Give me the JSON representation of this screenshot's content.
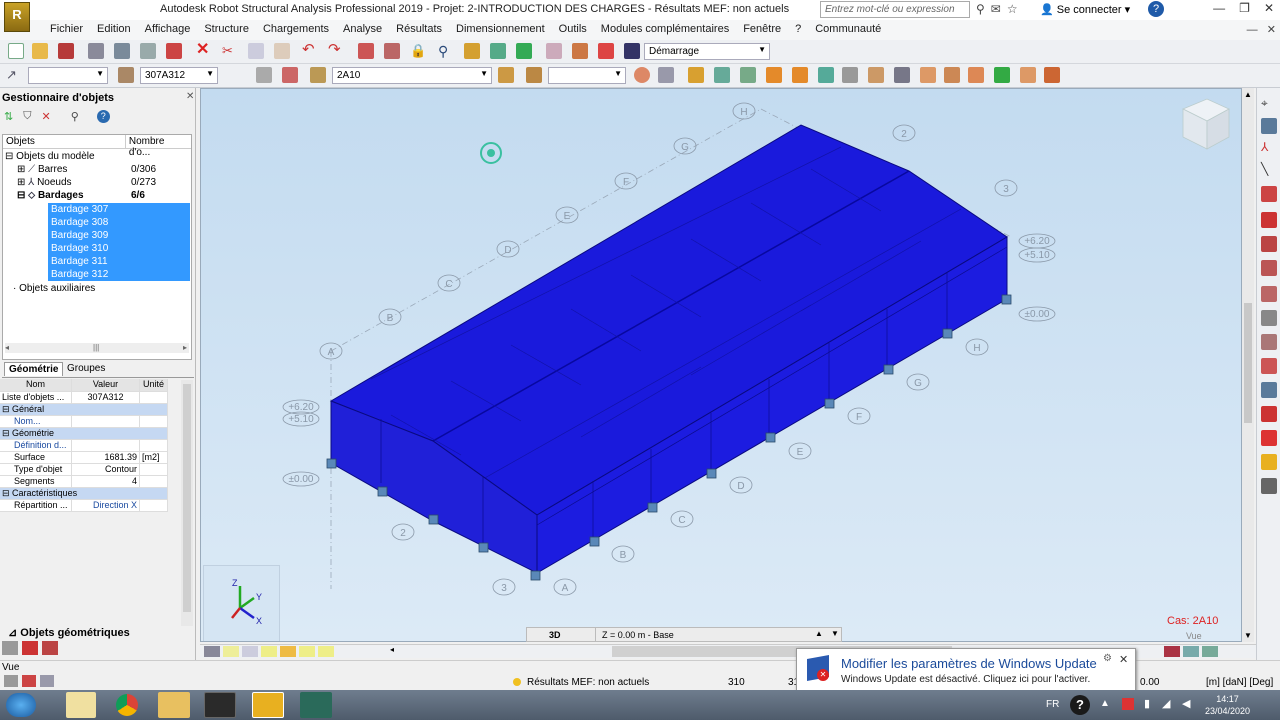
{
  "titlebar": {
    "logo": "R",
    "title": "Autodesk Robot Structural Analysis Professional 2019 - Projet: 2-INTRODUCTION DES CHARGES - Résultats MEF: non actuels",
    "search_placeholder": "Entrez mot-clé ou expression",
    "user": "Se connecter",
    "help": "?"
  },
  "menu": {
    "items": [
      "Fichier",
      "Edition",
      "Affichage",
      "Structure",
      "Chargements",
      "Analyse",
      "Résultats",
      "Dimensionnement",
      "Outils",
      "Modules complémentaires",
      "Fenêtre",
      "?",
      "Communauté"
    ]
  },
  "toolbar1": {
    "layout_select": "Démarrage"
  },
  "toolbar2": {
    "section_select": "307A312",
    "case_select": "2A10"
  },
  "object_manager": {
    "title": "Gestionnaire d'objets",
    "col_objects": "Objets",
    "col_count": "Nombre d'o...",
    "root": "Objets du modèle",
    "nodes": [
      {
        "label": "Barres",
        "count": "0/306"
      },
      {
        "label": "Noeuds",
        "count": "0/273"
      },
      {
        "label": "Bardages",
        "count": "6/6"
      }
    ],
    "claddings": [
      "Bardage   307",
      "Bardage   308",
      "Bardage   309",
      "Bardage   310",
      "Bardage   311",
      "Bardage   312"
    ],
    "aux": "Objets auxiliaires",
    "tab_geometry": "Géométrie",
    "tab_groups": "Groupes"
  },
  "properties": {
    "head": [
      "Nom",
      "Valeur",
      "Unité"
    ],
    "rows": [
      {
        "name": "Liste d'objets ...",
        "value": "307A312",
        "unit": "",
        "type": "plain"
      },
      {
        "name": "Général",
        "value": "",
        "unit": "",
        "type": "group"
      },
      {
        "name": "Nom...",
        "value": "",
        "unit": "",
        "type": "sub"
      },
      {
        "name": "Géométrie",
        "value": "",
        "unit": "",
        "type": "group"
      },
      {
        "name": "Définition d...",
        "value": "",
        "unit": "",
        "type": "sub"
      },
      {
        "name": "Surface",
        "value": "1681.39",
        "unit": "[m2]",
        "type": "plain"
      },
      {
        "name": "Type d'objet",
        "value": "Contour",
        "unit": "",
        "type": "plain"
      },
      {
        "name": "Segments",
        "value": "4",
        "unit": "",
        "type": "plain"
      },
      {
        "name": "Caractéristiques",
        "value": "",
        "unit": "",
        "type": "group"
      },
      {
        "name": "Répartition ...",
        "value": "Direction X",
        "unit": "",
        "type": "sub"
      }
    ],
    "bottom_tab": "Objets géométriques"
  },
  "viewport": {
    "axis_labels": {
      "x": "X",
      "y": "Y",
      "z": "Z"
    },
    "gridlines_letters": [
      "A",
      "B",
      "C",
      "D",
      "E",
      "F",
      "G",
      "H"
    ],
    "gridlines_numbers": [
      "2",
      "3"
    ],
    "levels": [
      "+6.20",
      "+5.10",
      "±0.00"
    ],
    "case": "Cas: 2A10",
    "view_label": "Vue",
    "view_mode": "3D",
    "plane": "Z = 0.00 m - Base"
  },
  "status": {
    "left": "Vue",
    "results": "Résultats MEF: non actuels",
    "count1": "310",
    "count2": "31",
    "coord": "0.00",
    "units": "[m] [daN] [Deg]"
  },
  "notification": {
    "title": "Modifier les paramètres de Windows Update",
    "body": "Windows Update est désactivé. Cliquez ici pour l'activer."
  },
  "taskbar": {
    "lang": "FR",
    "time": "14:17",
    "date": "23/04/2020"
  }
}
